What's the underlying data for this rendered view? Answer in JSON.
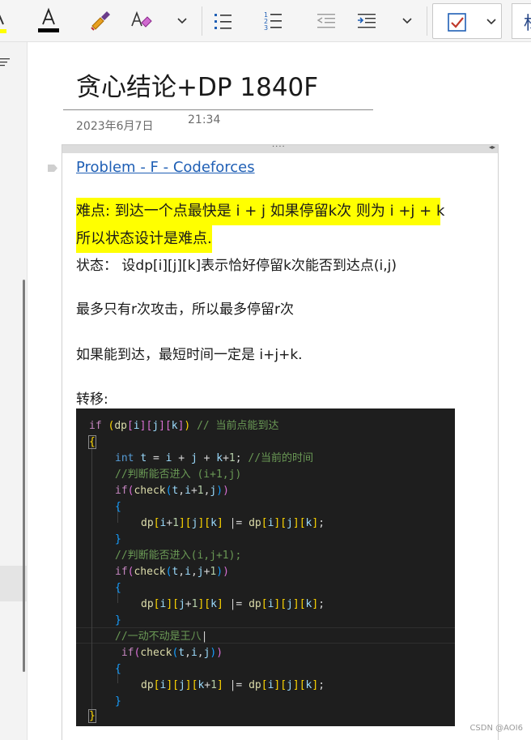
{
  "toolbar": {
    "icons": [
      "highlight-icon",
      "font-color-icon",
      "format-painter-icon",
      "clear-formatting-icon",
      "chevron-down-icon",
      "bulleted-list-icon",
      "numbered-list-icon",
      "decrease-indent-icon",
      "increase-indent-icon",
      "chevron-down-icon",
      "todo-tag-icon",
      "chevron-down-icon"
    ],
    "styles_glyph": "标",
    "font_color_bar": "#000000",
    "highlight_bar": "#ffff00",
    "tag_check_color": "#c0392b"
  },
  "page": {
    "title": "贪心结论+DP  1840F",
    "date": "2023年6月7日",
    "time": "21:34"
  },
  "note": {
    "link_text": "Problem - F - Codeforces",
    "highlight_line1": "难点: 到达一个点最快是 i + j 如果停留k次 则为 i +j + k",
    "highlight_line2": "所以状态设计是难点.",
    "state_line": "状态：   设dp[i][j][k]表示恰好停留k次能否到达点(i,j)",
    "para_attacks": "最多只有r次攻击，所以最多停留r次",
    "para_shortest": "如果能到达，最短时间一定是 i+j+k.",
    "transfer_label": "转移:"
  },
  "code": {
    "c1": "// 当前点能到达",
    "c2": "//当前的时间",
    "c3": "//判断能否进入 (i+1,j)",
    "c4": "//判断能否进入(i,j+1);",
    "c5": "//一动不动是王八"
  },
  "watermark": "CSDN @AOI6"
}
